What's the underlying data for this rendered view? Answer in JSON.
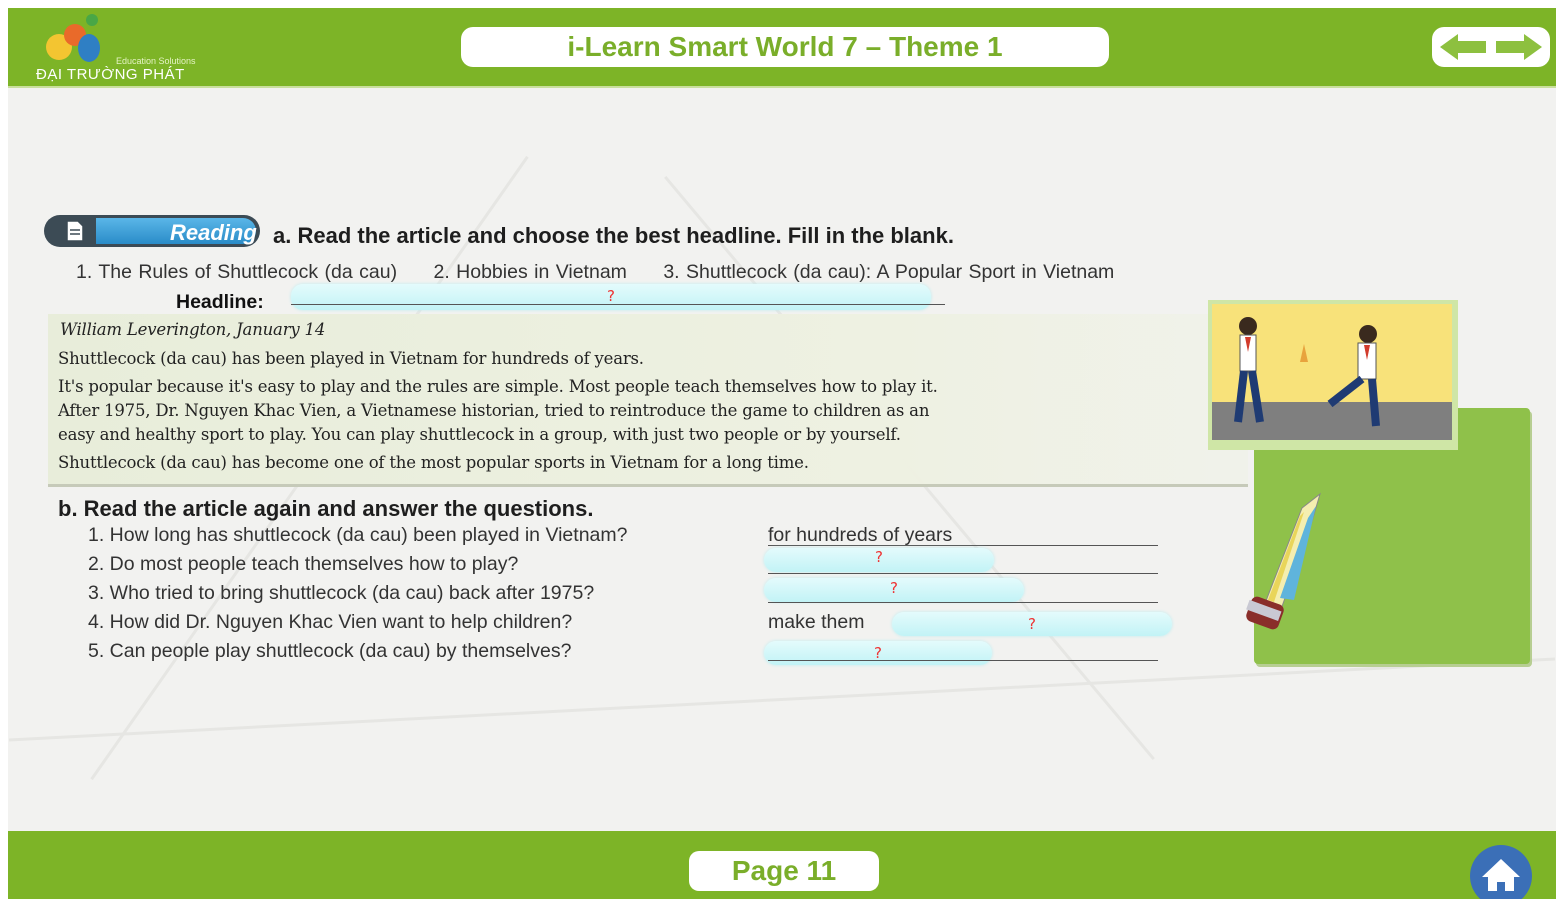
{
  "header": {
    "logo_tagline": "Education Solutions",
    "logo_name": "ĐẠI TRƯỜNG PHÁT",
    "title": "i-Learn Smart World 7 – Theme 1"
  },
  "section": {
    "badge": "Reading",
    "task_a": "a. Read the article and choose the best headline. Fill in the blank.",
    "options": [
      "1. The Rules of Shuttlecock (da cau)",
      "2. Hobbies in Vietnam",
      "3. Shuttlecock (da cau): A Popular Sport in Vietnam"
    ],
    "headline_label": "Headline:",
    "blank_marker": "?"
  },
  "article": {
    "byline": "William Leverington, January 14",
    "line1": "Shuttlecock (da cau) has been played in Vietnam for hundreds of years.",
    "line2": "It's popular because it's easy to play and the rules are simple. Most people teach themselves how to play it.",
    "line3": "After 1975, Dr. Nguyen Khac Vien, a Vietnamese historian, tried to reintroduce the game to children as an",
    "line4": "easy and healthy sport to play. You can play shuttlecock in a group, with just two people or by yourself.",
    "line5": "Shuttlecock (da cau) has become one of the most popular sports in Vietnam for a long time."
  },
  "task_b": {
    "title": "b. Read the article again and answer the questions.",
    "questions": [
      "1. How long has shuttlecock (da cau) been played in Vietnam?",
      "2. Do most people teach themselves how to play?",
      "3. Who tried to bring shuttlecock (da cau) back after 1975?",
      "4. How did Dr. Nguyen Khac Vien want to help children?",
      "5. Can people play shuttlecock (da cau) by themselves?"
    ],
    "answer1": "for hundreds of years",
    "answer4_prefix": "make them"
  },
  "footer": {
    "page": "Page  11"
  },
  "colors": {
    "brand_green": "#7db427",
    "title_text": "#7aae2a",
    "reading_blue": "#2a8cc8",
    "home_blue": "#3b6fb7"
  },
  "icons": [
    "logo-icon",
    "back-arrow-icon",
    "forward-arrow-icon",
    "document-icon",
    "home-icon"
  ]
}
